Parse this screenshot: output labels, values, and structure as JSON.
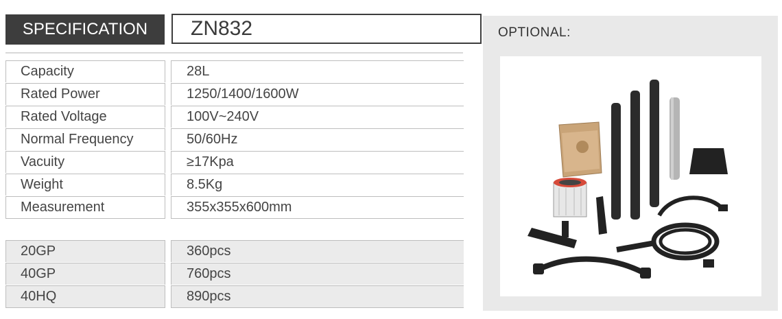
{
  "header": {
    "spec_label": "SPECIFICATION",
    "model": "ZN832"
  },
  "specs": [
    {
      "label": "Capacity",
      "value": "28L"
    },
    {
      "label": "Rated Power",
      "value": "1250/1400/1600W"
    },
    {
      "label": "Rated Voltage",
      "value": "100V~240V"
    },
    {
      "label": "Normal Frequency",
      "value": "50/60Hz"
    },
    {
      "label": "Vacuity",
      "value": "≥17Kpa"
    },
    {
      "label": "Weight",
      "value": "8.5Kg"
    },
    {
      "label": "Measurement",
      "value": "355x355x600mm"
    }
  ],
  "shipping": [
    {
      "label": "20GP",
      "value": "360pcs"
    },
    {
      "label": "40GP",
      "value": "760pcs"
    },
    {
      "label": "40HQ",
      "value": "890pcs"
    }
  ],
  "optional": {
    "label": "OPTIONAL:"
  },
  "colors": {
    "dark": "#3d3d3d",
    "border": "#bdbdbd",
    "shaded_row": "#ebebeb",
    "panel": "#e9e9e9"
  }
}
